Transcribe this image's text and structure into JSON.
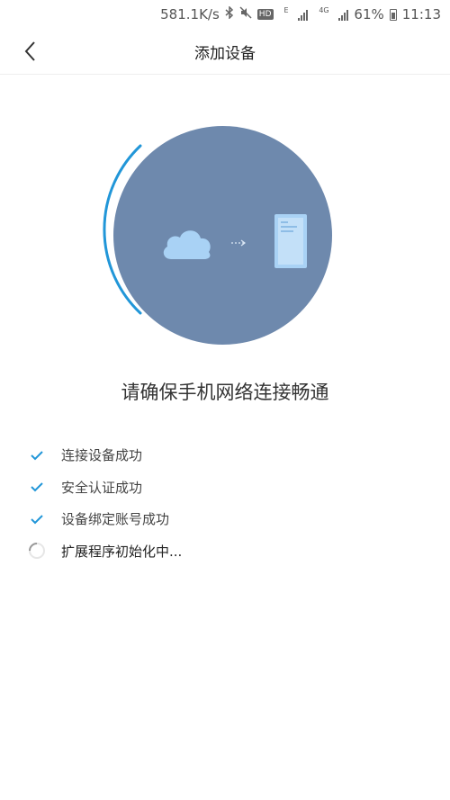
{
  "status_bar": {
    "network_speed": "581.1K/s",
    "bluetooth_icon": "bluetooth-icon",
    "mute_icon": "mute-icon",
    "hd_badge": "HD",
    "signal_1_badge": "E",
    "signal_2_badge": "4G",
    "battery_percent": "61%",
    "time": "11:13"
  },
  "header": {
    "title": "添加设备",
    "back_icon": "chevron-left-icon"
  },
  "illustration": {
    "circle_color": "#6e89ad",
    "arc_color": "#2196d8",
    "cloud_color": "#a9d2f5",
    "device_color": "#a9d2f5",
    "icons": [
      "cloud-icon",
      "arrow-icon",
      "device-icon"
    ]
  },
  "headline": "请确保手机网络连接畅通",
  "steps": [
    {
      "label": "连接设备成功",
      "status": "done",
      "icon": "check-icon"
    },
    {
      "label": "安全认证成功",
      "status": "done",
      "icon": "check-icon"
    },
    {
      "label": "设备绑定账号成功",
      "status": "done",
      "icon": "check-icon"
    },
    {
      "label": "扩展程序初始化中...",
      "status": "in-progress",
      "icon": "spinner-icon"
    }
  ],
  "colors": {
    "accent": "#2196d8",
    "check": "#2196d8"
  }
}
